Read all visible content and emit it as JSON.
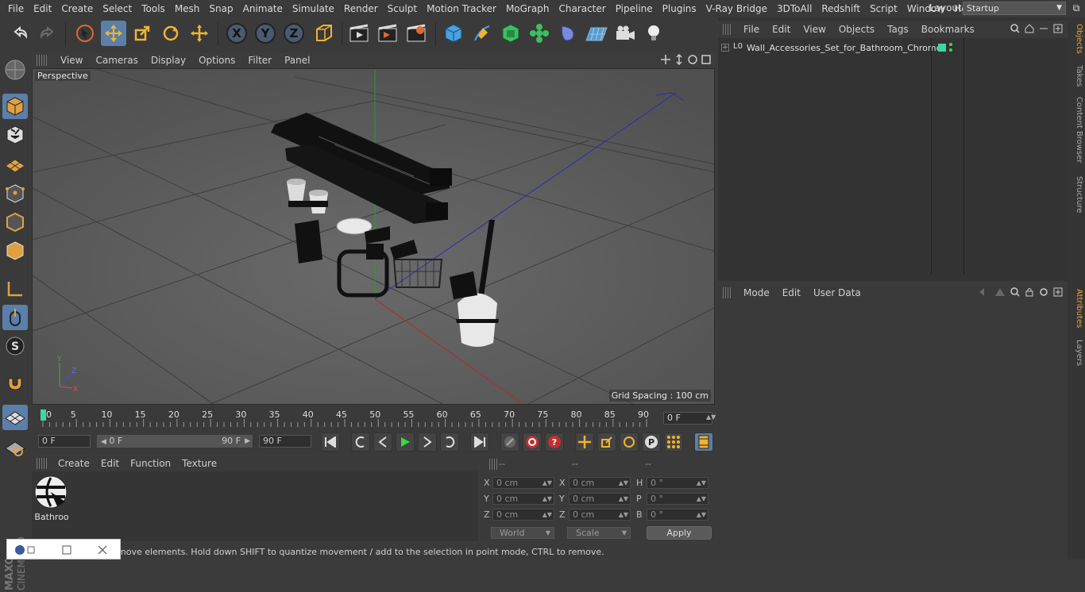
{
  "menubar": {
    "items": [
      "File",
      "Edit",
      "Create",
      "Select",
      "Tools",
      "Mesh",
      "Snap",
      "Animate",
      "Simulate",
      "Render",
      "Sculpt",
      "Motion Tracker",
      "MoGraph",
      "Character",
      "Pipeline",
      "Plugins",
      "V-Ray Bridge",
      "3DToAll",
      "Redshift",
      "Script",
      "Window",
      "Help"
    ],
    "layout_label": "Layout:",
    "layout_value": "Startup"
  },
  "toolbar": {
    "icons": [
      "undo-icon",
      "redo-icon",
      "live-selection-icon",
      "move-icon",
      "scale-icon",
      "rotate-icon",
      "move-tool-icon",
      "x-axis-icon",
      "y-axis-icon",
      "z-axis-icon",
      "coordinate-system-icon",
      "render-view-icon",
      "render-picture-viewer-icon",
      "render-settings-icon",
      "cube-icon",
      "pen-icon",
      "subdivision-icon",
      "cloner-icon",
      "deformer-icon",
      "floor-icon",
      "camera-icon",
      "light-icon"
    ],
    "axis_labels": [
      "X",
      "Y",
      "Z"
    ]
  },
  "viewport": {
    "menu": [
      "View",
      "Cameras",
      "Display",
      "Options",
      "Filter",
      "Panel"
    ],
    "label": "Perspective",
    "grid_spacing": "Grid Spacing : 100 cm"
  },
  "timeline": {
    "ticks": [
      "0",
      "5",
      "10",
      "15",
      "20",
      "25",
      "30",
      "35",
      "40",
      "45",
      "50",
      "55",
      "60",
      "65",
      "70",
      "75",
      "80",
      "85",
      "90"
    ],
    "current_frame": "0 F"
  },
  "transport": {
    "start_field": "0 F",
    "range_start": "0 F",
    "range_end": "90 F",
    "end_field": "90 F"
  },
  "materials": {
    "menu": [
      "Create",
      "Edit",
      "Function",
      "Texture"
    ],
    "items": [
      {
        "label": "Bathroo"
      }
    ]
  },
  "coordinates": {
    "headers": [
      "--",
      "--",
      "--"
    ],
    "rows": [
      {
        "l1": "X",
        "v1": "0 cm",
        "l2": "X",
        "v2": "0 cm",
        "l3": "H",
        "v3": "0 °"
      },
      {
        "l1": "Y",
        "v1": "0 cm",
        "l2": "Y",
        "v2": "0 cm",
        "l3": "P",
        "v3": "0 °"
      },
      {
        "l1": "Z",
        "v1": "0 cm",
        "l2": "Z",
        "v2": "0 cm",
        "l3": "B",
        "v3": "0 °"
      }
    ],
    "mode1": "World",
    "mode2": "Scale",
    "apply": "Apply"
  },
  "status": {
    "text": "move elements. Hold down SHIFT to quantize movement / add to the selection in point mode, CTRL to remove."
  },
  "objects": {
    "menu": [
      "File",
      "Edit",
      "View",
      "Objects",
      "Tags",
      "Bookmarks"
    ],
    "items": [
      {
        "name": "Wall_Accessories_Set_for_Bathroom_Chrome",
        "layer": "L0",
        "tag_color": "#3fd6a0"
      }
    ]
  },
  "attributes": {
    "menu": [
      "Mode",
      "Edit",
      "User Data"
    ]
  },
  "right_tabs": [
    "Objects",
    "Takes",
    "Content Browser",
    "Structure",
    "Attributes",
    "Layers"
  ],
  "branding": {
    "maker": "MAXON",
    "product": "CINEMA 4D"
  },
  "colors": {
    "accent": "#5a7fa8",
    "active_tab": "#e8a33a",
    "timeline_marker": "#3fd6a0"
  }
}
